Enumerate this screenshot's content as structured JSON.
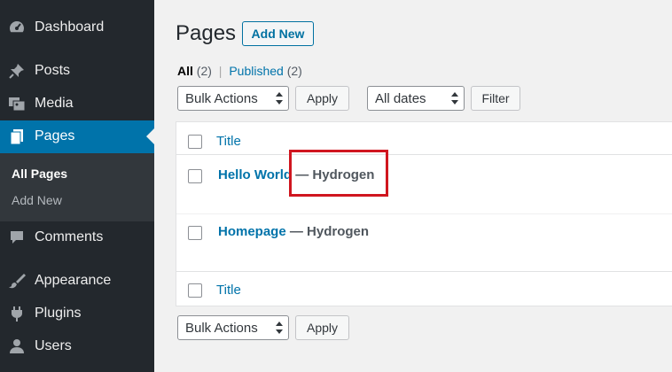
{
  "sidebar": {
    "items": [
      {
        "label": "Dashboard",
        "icon": "dashboard-icon"
      },
      {
        "label": "Posts",
        "icon": "pushpin-icon"
      },
      {
        "label": "Media",
        "icon": "media-icon"
      },
      {
        "label": "Pages",
        "icon": "pages-icon",
        "active": true
      },
      {
        "label": "Comments",
        "icon": "comment-icon"
      },
      {
        "label": "Appearance",
        "icon": "paintbrush-icon"
      },
      {
        "label": "Plugins",
        "icon": "plugin-icon"
      },
      {
        "label": "Users",
        "icon": "user-icon"
      }
    ],
    "submenu": [
      {
        "label": "All Pages",
        "current": true
      },
      {
        "label": "Add New"
      }
    ]
  },
  "header": {
    "title": "Pages",
    "add_new_label": "Add New"
  },
  "filters": {
    "all_label": "All",
    "all_count": "(2)",
    "separator": "|",
    "published_label": "Published",
    "published_count": "(2)"
  },
  "toolbar_top": {
    "bulk_actions": "Bulk Actions",
    "apply_label": "Apply",
    "dates": "All dates",
    "filter_label": "Filter"
  },
  "table": {
    "header_title": "Title",
    "footer_title": "Title",
    "rows": [
      {
        "title": "Hello World",
        "dash": "—",
        "state": "Hydrogen"
      },
      {
        "title": "Homepage",
        "dash": "—",
        "state": "Hydrogen"
      }
    ]
  },
  "toolbar_bottom": {
    "bulk_actions": "Bulk Actions",
    "apply_label": "Apply"
  },
  "colors": {
    "sidebar_bg": "#23282d",
    "active_bg": "#0073aa",
    "link": "#0073aa",
    "highlight": "#d0161f"
  }
}
